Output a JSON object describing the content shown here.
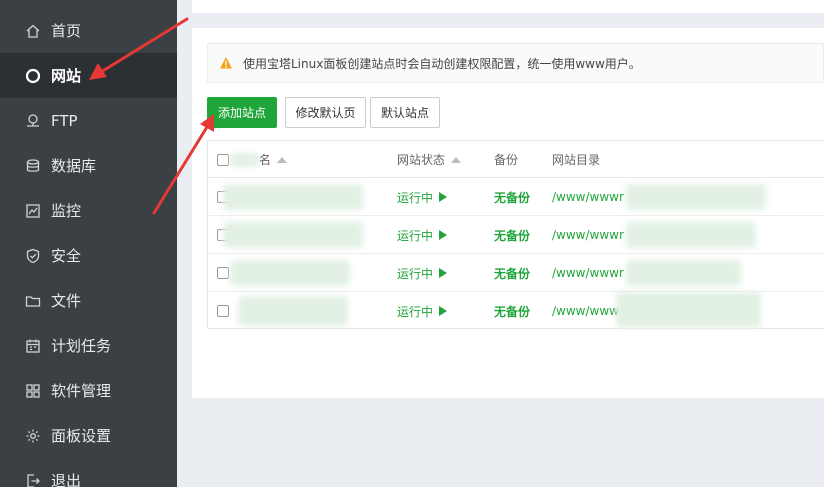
{
  "sidebar": {
    "items": [
      {
        "label": "首页",
        "icon": "home-icon",
        "active": false
      },
      {
        "label": "网站",
        "icon": "globe-icon",
        "active": true
      },
      {
        "label": "FTP",
        "icon": "ftp-icon",
        "active": false
      },
      {
        "label": "数据库",
        "icon": "database-icon",
        "active": false
      },
      {
        "label": "监控",
        "icon": "monitor-icon",
        "active": false
      },
      {
        "label": "安全",
        "icon": "shield-icon",
        "active": false
      },
      {
        "label": "文件",
        "icon": "folder-icon",
        "active": false
      },
      {
        "label": "计划任务",
        "icon": "calendar-icon",
        "active": false
      },
      {
        "label": "软件管理",
        "icon": "apps-icon",
        "active": false
      },
      {
        "label": "面板设置",
        "icon": "gear-icon",
        "active": false
      },
      {
        "label": "退出",
        "icon": "logout-icon",
        "active": false
      }
    ]
  },
  "notice": {
    "text": "使用宝塔Linux面板创建站点时会自动创建权限配置，统一使用www用户。",
    "icon": "warning-icon"
  },
  "toolbar": {
    "add_site": "添加站点",
    "edit_default_page": "修改默认页",
    "default_site": "默认站点"
  },
  "table": {
    "columns": {
      "name": "名",
      "status": "网站状态",
      "backup": "备份",
      "directory": "网站目录"
    },
    "rows": [
      {
        "status": "运行中",
        "backup": "无备份",
        "path": "/www/wwwr"
      },
      {
        "status": "运行中",
        "backup": "无备份",
        "path": "/www/wwwr"
      },
      {
        "status": "运行中",
        "backup": "无备份",
        "path": "/www/wwwr"
      },
      {
        "status": "运行中",
        "backup": "无备份",
        "path": "/www/www"
      }
    ]
  },
  "colors": {
    "sidebar_bg": "#3b4045",
    "sidebar_active": "#2c3034",
    "accent_green": "#20a53a",
    "annotation_red": "#e53935"
  }
}
